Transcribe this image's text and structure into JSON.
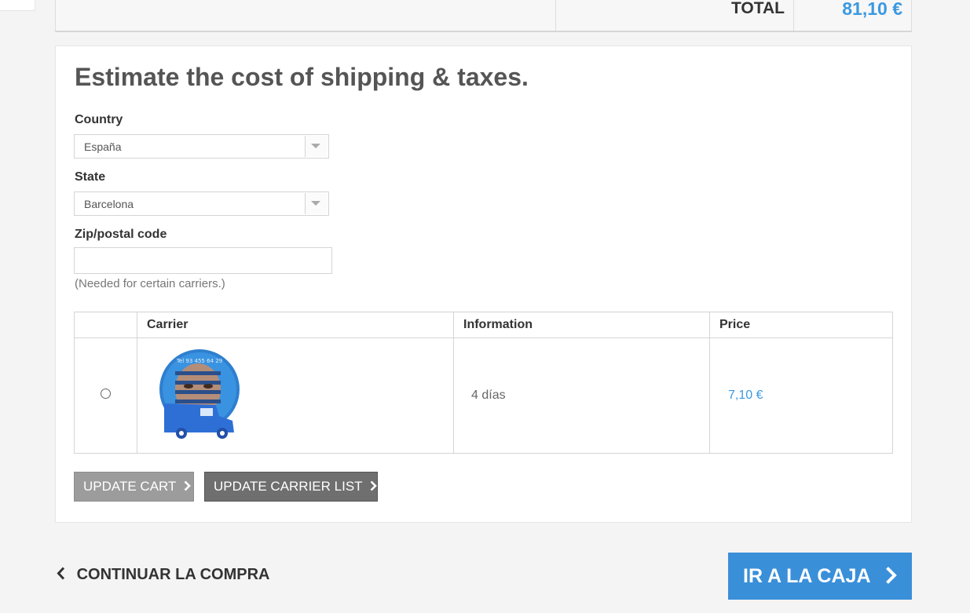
{
  "cart_total": {
    "label": "TOTAL",
    "value": "81,10 €"
  },
  "shipping_estimate": {
    "title": "Estimate the cost of shipping & taxes.",
    "country": {
      "label": "Country",
      "selected": "España"
    },
    "state": {
      "label": "State",
      "selected": "Barcelona"
    },
    "zip": {
      "label": "Zip/postal code",
      "value": "",
      "hint": "(Needed for certain carriers.)"
    },
    "table": {
      "headers": [
        "",
        "Carrier",
        "Information",
        "Price"
      ],
      "rows": [
        {
          "selected": false,
          "logo_text": "Tel 93 455 64 29",
          "information": "4 días",
          "price": "7,10 €"
        }
      ]
    },
    "buttons": {
      "update_cart": "UPDATE CART",
      "update_carrier_list": "UPDATE CARRIER LIST"
    }
  },
  "footer": {
    "continue_shopping": "CONTINUAR LA COMPRA",
    "checkout": "IR A LA CAJA"
  },
  "colors": {
    "accent": "#3b99e0",
    "checkout_button": "#3a8fd9",
    "update_cart_button": "#9c9c9c",
    "update_carrier_button": "#6f6f6f"
  },
  "icons": [
    "dropdown-arrow-icon",
    "chevron-right-icon",
    "chevron-left-icon",
    "carrier-logo"
  ]
}
